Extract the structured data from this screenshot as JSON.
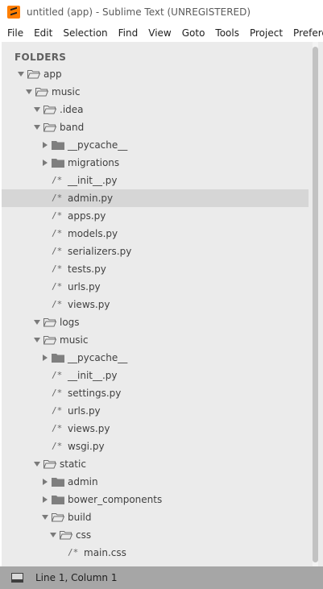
{
  "window": {
    "title": "untitled (app) - Sublime Text (UNREGISTERED)"
  },
  "menu": [
    "File",
    "Edit",
    "Selection",
    "Find",
    "View",
    "Goto",
    "Tools",
    "Project",
    "Preferences"
  ],
  "sidebar": {
    "header": "FOLDERS",
    "items": [
      {
        "label": "app",
        "type": "folder",
        "depth": 0,
        "open": true
      },
      {
        "label": "music",
        "type": "folder",
        "depth": 1,
        "open": true
      },
      {
        "label": ".idea",
        "type": "folder",
        "depth": 2,
        "open": true
      },
      {
        "label": "band",
        "type": "folder",
        "depth": 2,
        "open": true
      },
      {
        "label": "__pycache__",
        "type": "folder",
        "depth": 3,
        "open": false
      },
      {
        "label": "migrations",
        "type": "folder",
        "depth": 3,
        "open": false
      },
      {
        "label": "__init__.py",
        "type": "file",
        "depth": 3
      },
      {
        "label": "admin.py",
        "type": "file",
        "depth": 3,
        "selected": true
      },
      {
        "label": "apps.py",
        "type": "file",
        "depth": 3
      },
      {
        "label": "models.py",
        "type": "file",
        "depth": 3
      },
      {
        "label": "serializers.py",
        "type": "file",
        "depth": 3
      },
      {
        "label": "tests.py",
        "type": "file",
        "depth": 3
      },
      {
        "label": "urls.py",
        "type": "file",
        "depth": 3
      },
      {
        "label": "views.py",
        "type": "file",
        "depth": 3
      },
      {
        "label": "logs",
        "type": "folder",
        "depth": 2,
        "open": true
      },
      {
        "label": "music",
        "type": "folder",
        "depth": 2,
        "open": true
      },
      {
        "label": "__pycache__",
        "type": "folder",
        "depth": 3,
        "open": false
      },
      {
        "label": "__init__.py",
        "type": "file",
        "depth": 3
      },
      {
        "label": "settings.py",
        "type": "file",
        "depth": 3
      },
      {
        "label": "urls.py",
        "type": "file",
        "depth": 3
      },
      {
        "label": "views.py",
        "type": "file",
        "depth": 3
      },
      {
        "label": "wsgi.py",
        "type": "file",
        "depth": 3
      },
      {
        "label": "static",
        "type": "folder",
        "depth": 2,
        "open": true
      },
      {
        "label": "admin",
        "type": "folder",
        "depth": 3,
        "open": false
      },
      {
        "label": "bower_components",
        "type": "folder",
        "depth": 3,
        "open": false
      },
      {
        "label": "build",
        "type": "folder",
        "depth": 3,
        "open": true
      },
      {
        "label": "css",
        "type": "folder",
        "depth": 4,
        "open": true
      },
      {
        "label": "main.css",
        "type": "file",
        "depth": 5
      }
    ]
  },
  "status": {
    "position": "Line 1, Column 1"
  },
  "icons": {
    "file_glyph": "/*"
  },
  "colors": {
    "logo": "#ff7e00",
    "sidebar_bg": "#ebebeb",
    "selected_row": "#d6d6d6",
    "statusbar_bg": "#a6a6a6"
  }
}
